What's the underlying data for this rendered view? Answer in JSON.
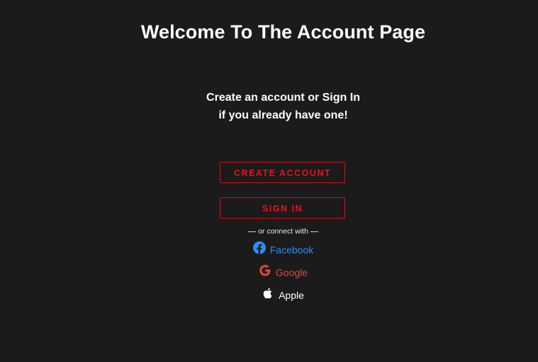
{
  "page": {
    "title": "Welcome To The Account Page",
    "subtitle_line1": "Create an account or Sign In",
    "subtitle_line2": "if you already have one!"
  },
  "actions": {
    "create_account_label": "CREATE ACCOUNT",
    "sign_in_label": "SIGN IN"
  },
  "connect": {
    "divider_text": "or connect with",
    "providers": [
      {
        "label": "Facebook",
        "icon": "facebook-icon",
        "color": "#2d8cf0"
      },
      {
        "label": "Google",
        "icon": "google-icon",
        "color": "#e8433a"
      },
      {
        "label": "Apple",
        "icon": "apple-icon",
        "color": "#ffffff"
      }
    ]
  },
  "theme": {
    "background": "#1b1b1c",
    "accent": "#e3121b"
  }
}
